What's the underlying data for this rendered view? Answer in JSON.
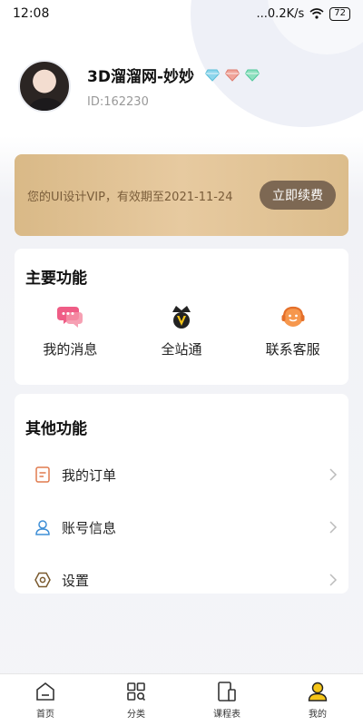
{
  "status_bar": {
    "time": "12:08",
    "network_speed": "...0.2K/s",
    "battery": "72"
  },
  "profile": {
    "name": "3D溜溜网-妙妙",
    "id": "ID:162230",
    "badges": [
      "diamond-blue",
      "diamond-red",
      "diamond-green"
    ]
  },
  "vip": {
    "text": "您的UI设计VIP，有效期至2021-11-24",
    "renew_label": "立即续费"
  },
  "main_functions": {
    "title": "主要功能",
    "items": [
      {
        "label": "我的消息",
        "icon": "message-icon"
      },
      {
        "label": "全站通",
        "icon": "vip-crown-icon"
      },
      {
        "label": "联系客服",
        "icon": "customer-service-icon"
      }
    ]
  },
  "other_functions": {
    "title": "其他功能",
    "items": [
      {
        "label": "我的订单",
        "icon": "order-icon"
      },
      {
        "label": "账号信息",
        "icon": "account-icon"
      },
      {
        "label": "设置",
        "icon": "settings-icon"
      }
    ]
  },
  "tab_bar": {
    "tabs": [
      {
        "label": "首页",
        "icon": "home-icon"
      },
      {
        "label": "分类",
        "icon": "category-icon"
      },
      {
        "label": "课程表",
        "icon": "schedule-icon"
      },
      {
        "label": "我的",
        "icon": "profile-icon",
        "active": true
      }
    ]
  },
  "colors": {
    "vip_gold": "#dcbd8c",
    "renew_button": "#7d6853",
    "active_tab": "#f5c518"
  }
}
